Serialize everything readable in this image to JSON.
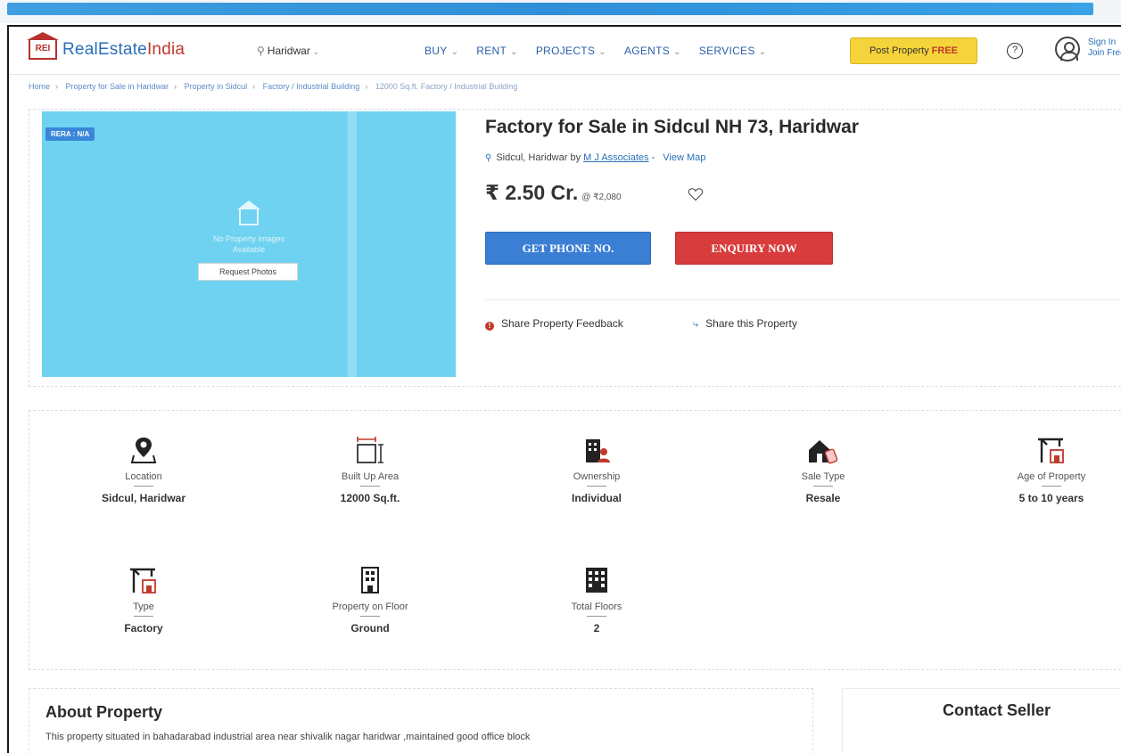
{
  "header": {
    "logo": {
      "mark": "REI",
      "name_part1": "RealEstate",
      "name_part2": "India"
    },
    "city": "Haridwar",
    "nav": [
      "BUY",
      "RENT",
      "PROJECTS",
      "AGENTS",
      "SERVICES"
    ],
    "post_property": {
      "prefix": "Post Property ",
      "emphasis": "FREE"
    },
    "help_glyph": "?",
    "sign_in": {
      "line1": "Sign In",
      "line2": "Join Free"
    }
  },
  "breadcrumb": [
    "Home",
    "Property for Sale in Haridwar",
    "Property in Sidcul",
    "Factory / Industrial Building",
    "12000 Sq.ft. Factory / Industrial Building"
  ],
  "gallery": {
    "rera": "RERA : N/A",
    "no_images_line1": "No Property Images",
    "no_images_line2": "Available",
    "request_photos": "Request Photos"
  },
  "property": {
    "title": "Factory for Sale in Sidcul NH 73, Haridwar",
    "location_prefix": "Sidcul, Haridwar by ",
    "agent": "M J Associates",
    "location_sep": " - ",
    "view_map": "View Map",
    "price": "₹ 2.50 Cr.",
    "price_per": "@ ₹2,080",
    "get_phone": "GET PHONE NO.",
    "enquiry": "ENQUIRY NOW",
    "share_feedback": "Share Property Feedback",
    "share_property": "Share this Property"
  },
  "features": [
    {
      "label": "Location",
      "value": "Sidcul, Haridwar",
      "icon": "location-pin-icon"
    },
    {
      "label": "Built Up Area",
      "value": "12000 Sq.ft.",
      "icon": "area-measure-icon"
    },
    {
      "label": "Ownership",
      "value": "Individual",
      "icon": "ownership-icon"
    },
    {
      "label": "Sale Type",
      "value": "Resale",
      "icon": "sale-type-icon"
    },
    {
      "label": "Age of Property",
      "value": "5 to 10 years",
      "icon": "construction-crane-icon"
    },
    {
      "label": "Type",
      "value": "Factory",
      "icon": "factory-crane-icon"
    },
    {
      "label": "Property on Floor",
      "value": "Ground",
      "icon": "building-floor-icon"
    },
    {
      "label": "Total Floors",
      "value": "2",
      "icon": "building-icon"
    }
  ],
  "about": {
    "heading": "About Property",
    "text": "This property situated in bahadarabad industrial area near shivalik nagar haridwar ,maintained good office block"
  },
  "contact": {
    "heading": "Contact Seller"
  }
}
